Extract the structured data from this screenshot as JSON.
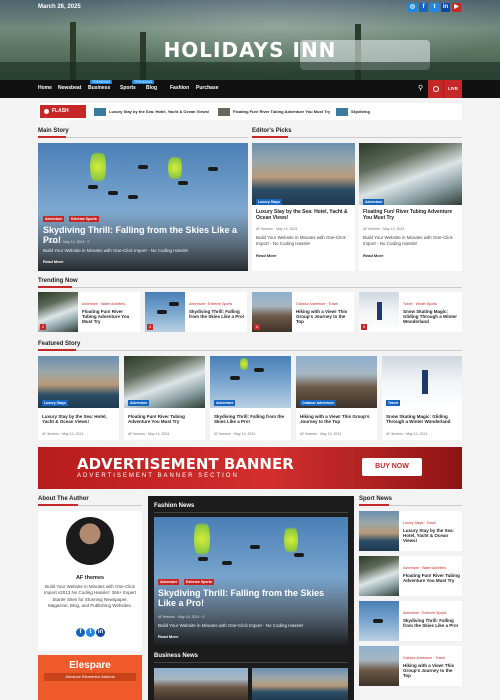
{
  "topbar": {
    "date": "March 26, 2025",
    "social": [
      "instagram-icon",
      "facebook-icon",
      "twitter-icon",
      "linkedin-icon",
      "youtube-icon"
    ]
  },
  "site": {
    "title": "HOLIDAYS INN"
  },
  "nav": {
    "items": [
      "Home",
      "Newsbeat",
      "Business",
      "Sports",
      "Blog",
      "Fashion",
      "Purchase"
    ],
    "tags": {
      "business": "TRENDING",
      "sports": "TRENDING"
    },
    "live": "LIVE"
  },
  "flash": {
    "label": "FLASH STORY",
    "items": [
      "Luxury Stay by the Sea: Hotel, Yacht & Ocean Views!",
      "Floating Fun! River Tubing Adventure You Must Try",
      "Skydiving"
    ]
  },
  "main_story": {
    "heading": "Main Story",
    "cats": [
      "Adventure",
      "Extreme Sports"
    ],
    "title": "Skydiving Thrill: Falling from the Skies Like a Pro!",
    "author": "AF themes",
    "date": "May 14, 2024",
    "comments": "0",
    "excerpt": "Build Your Website in Minutes with One-Click Import - No Coding Hassle!",
    "read_more": "Read More"
  },
  "editors": {
    "heading": "Editor's Picks",
    "items": [
      {
        "cat": "Luxury Stays",
        "cat2": "Travel",
        "title": "Luxury Stay by the Sea: Hotel, Yacht & Ocean Views!",
        "author": "AF themes",
        "date": "May 14, 2024",
        "comments": "0",
        "excerpt": "Build Your Website in Minutes with One-Click Import - No Coding Hassle!",
        "read_more": "Read More"
      },
      {
        "cat": "Adventure",
        "cat2": "Water Activities",
        "title": "Floating Fun! River Tubing Adventure You Must Try",
        "author": "AF themes",
        "date": "May 14, 2024",
        "comments": "0",
        "excerpt": "Build Your Website in Minutes with One-Click Import - No Coding Hassle!",
        "read_more": "Read More"
      }
    ]
  },
  "trending": {
    "heading": "Trending Now",
    "items": [
      {
        "cats": "Adventure · Water Activities",
        "title": "Floating Fun! River Tubing Adventure You Must Try",
        "num": "2"
      },
      {
        "cats": "Adventure · Extreme Sports",
        "title": "Skydiving Thrill: Falling from the Skies Like a Pro!",
        "num": "3"
      },
      {
        "cats": "Outdoor Adventure · Travel",
        "title": "Hiking with a View! This Group's Journey to the Top",
        "num": "4"
      },
      {
        "cats": "Travel · Winter Sports",
        "title": "Snow Skating Magic: Gliding Through a Winter Wonderland",
        "num": "5"
      }
    ]
  },
  "featured": {
    "heading": "Featured Story",
    "items": [
      {
        "cat": "Luxury Stays",
        "cat2": "Travel",
        "title": "Luxury Stay by the Sea: Hotel, Yacht & Ocean Views!",
        "author": "AF themes",
        "date": "May 14, 2024",
        "comments": "0"
      },
      {
        "cat": "Adventure",
        "cat2": "Water Activities",
        "title": "Floating Fun! River Tubing Adventure You Must Try",
        "author": "AF themes",
        "date": "May 14, 2024",
        "comments": "0"
      },
      {
        "cat": "Adventure",
        "cat2": "Extreme Sports",
        "title": "Skydiving Thrill: Falling from the Skies Like a Pro!",
        "author": "AF themes",
        "date": "May 14, 2024",
        "comments": "0"
      },
      {
        "cat": "Outdoor Adventure",
        "cat2": "Travel",
        "title": "Hiking with a View! This Group's Journey to the Top",
        "author": "AF themes",
        "date": "May 14, 2024",
        "comments": "0"
      },
      {
        "cat": "Travel",
        "cat2": "Winter Sports",
        "title": "Snow Skating Magic: Gliding Through a Winter Wonderland",
        "author": "AF themes",
        "date": "May 14, 2024",
        "comments": "0"
      }
    ]
  },
  "ad": {
    "title": "ADVERTISEMENT BANNER",
    "subtitle": "ADVERTISEMENT BANNER SECTION",
    "button": "BUY NOW"
  },
  "about": {
    "heading": "About The Author",
    "name": "AF themes",
    "bio": "Build Your Website in Minutes with One-Click Import v2013 No Coding Hassle!: 365+ Expert Starter Sites for Stunning Newspaper, Magazine, Blog, and Publishing Websites."
  },
  "elespare": {
    "title": "Elespare",
    "subtitle": "Advance Elementor Addons"
  },
  "fashion": {
    "heading": "Fashion News",
    "cats": [
      "Adventure",
      "Extreme Sports"
    ],
    "title": "Skydiving Thrill: Falling from the Skies Like a Pro!",
    "author": "AF themes",
    "date": "May 14, 2024",
    "comments": "0",
    "excerpt": "Build Your Website in Minutes with One-Click Import - No Coding Hassle!",
    "read_more": "Read More",
    "business_heading": "Business News"
  },
  "sports": {
    "heading": "Sport News",
    "items": [
      {
        "cats": "Luxury Stays · Travel",
        "title": "Luxury Stay by the Sea: Hotel, Yacht & Ocean Views!"
      },
      {
        "cats": "Adventure · Water Activities",
        "title": "Floating Fun! River Tubing Adventure You Must Try"
      },
      {
        "cats": "Adventure · Extreme Sports",
        "title": "Skydiving Thrill: Falling from the Skies Like a Pro!"
      },
      {
        "cats": "Outdoor Adventure · Travel",
        "title": "Hiking with a View! This Group's Journey to the Top"
      }
    ]
  },
  "colors": {
    "accent": "#c62828",
    "nav": "#111111",
    "tag": "#1565c0"
  }
}
